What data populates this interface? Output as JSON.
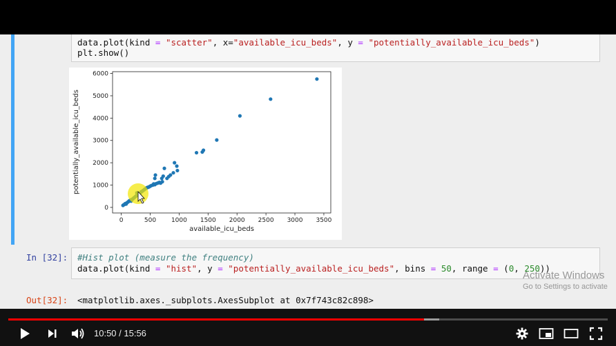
{
  "notebook": {
    "cell1": {
      "code_line1": {
        "a": "data.plot(kind ",
        "b": "=",
        "c": " \"scatter\"",
        "d": ", x=",
        "e": "\"available_icu_beds\"",
        "f": ", y ",
        "g": "=",
        "h": " \"potentially_available_icu_beds\"",
        "i": ")"
      },
      "code_line2": "plt.show()"
    },
    "cell2": {
      "prompt": "In [32]:",
      "comment": "#Hist plot (measure the frequency)",
      "code": {
        "a": "data.plot(kind ",
        "b": "=",
        "c": " \"hist\"",
        "d": ", y ",
        "e": "=",
        "f": " \"potentially_available_icu_beds\"",
        "g": ", bins ",
        "h": "=",
        "i": " 50",
        "j": ", range ",
        "k": "=",
        "l": " (",
        "m": "0",
        "n": ", ",
        "o": "250",
        "p": "))"
      }
    },
    "output": {
      "prompt": "Out[32]:",
      "text": "<matplotlib.axes._subplots.AxesSubplot at 0x7f743c82c898>"
    }
  },
  "chart_data": {
    "type": "scatter",
    "xlabel": "available_icu_beds",
    "ylabel": "potentially_available_icu_beds",
    "xlim": [
      -150,
      3620
    ],
    "ylim": [
      -250,
      6080
    ],
    "xticks": [
      0,
      500,
      1000,
      1500,
      2000,
      2500,
      3000,
      3500
    ],
    "yticks": [
      0,
      1000,
      2000,
      3000,
      4000,
      5000,
      6000
    ],
    "color": "#1f77b4",
    "points": [
      [
        30,
        90
      ],
      [
        45,
        120
      ],
      [
        60,
        140
      ],
      [
        70,
        170
      ],
      [
        85,
        150
      ],
      [
        95,
        200
      ],
      [
        110,
        230
      ],
      [
        125,
        260
      ],
      [
        140,
        300
      ],
      [
        160,
        330
      ],
      [
        170,
        280
      ],
      [
        185,
        360
      ],
      [
        200,
        380
      ],
      [
        215,
        420
      ],
      [
        230,
        450
      ],
      [
        250,
        500
      ],
      [
        265,
        520
      ],
      [
        280,
        560
      ],
      [
        300,
        600
      ],
      [
        315,
        620
      ],
      [
        330,
        650
      ],
      [
        345,
        700
      ],
      [
        360,
        720
      ],
      [
        380,
        760
      ],
      [
        400,
        800
      ],
      [
        420,
        840
      ],
      [
        440,
        880
      ],
      [
        460,
        900
      ],
      [
        480,
        920
      ],
      [
        500,
        950
      ],
      [
        520,
        980
      ],
      [
        545,
        1000
      ],
      [
        560,
        1050
      ],
      [
        580,
        1020
      ],
      [
        600,
        1060
      ],
      [
        620,
        1080
      ],
      [
        640,
        1100
      ],
      [
        660,
        1120
      ],
      [
        680,
        1090
      ],
      [
        700,
        1300
      ],
      [
        710,
        1150
      ],
      [
        725,
        1400
      ],
      [
        745,
        1750
      ],
      [
        790,
        1300
      ],
      [
        820,
        1380
      ],
      [
        850,
        1450
      ],
      [
        900,
        1550
      ],
      [
        920,
        2000
      ],
      [
        960,
        1850
      ],
      [
        970,
        1650
      ],
      [
        1300,
        2450
      ],
      [
        1400,
        2480
      ],
      [
        1420,
        2560
      ],
      [
        1650,
        3020
      ],
      [
        2050,
        4100
      ],
      [
        2580,
        4850
      ],
      [
        3380,
        5750
      ],
      [
        580,
        1300
      ],
      [
        590,
        1450
      ],
      [
        270,
        650
      ]
    ]
  },
  "highlight": {
    "cursor_color": "#f2e600"
  },
  "watermark": {
    "line1": "Activate Windows",
    "line2": "Go to Settings to activate"
  },
  "player": {
    "time": "10:50 / 15:56",
    "progress": 0.6937,
    "buffered": 0.7189,
    "colors": {
      "played": "#ff0000"
    }
  }
}
